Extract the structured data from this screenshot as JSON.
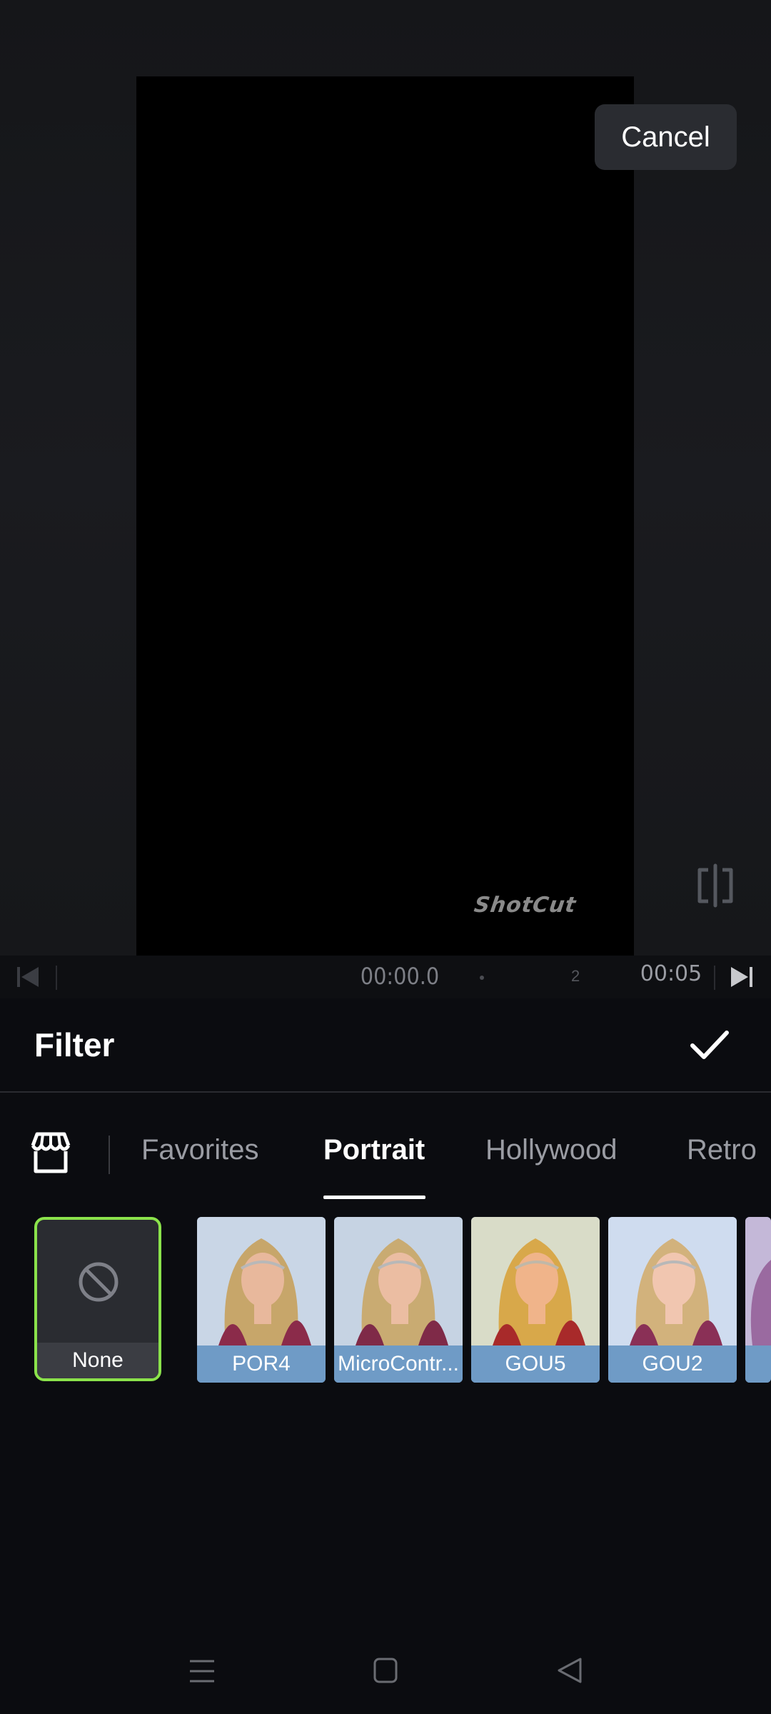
{
  "header": {
    "cancel_label": "Cancel"
  },
  "preview": {
    "watermark": "ShotCut"
  },
  "timeline": {
    "current_time": "00:00.0",
    "marker": "2",
    "end_time": "00:05"
  },
  "panel": {
    "title": "Filter"
  },
  "tabs": [
    {
      "label": "Favorites",
      "active": false
    },
    {
      "label": "Portrait",
      "active": true
    },
    {
      "label": "Hollywood",
      "active": false
    },
    {
      "label": "Retro",
      "active": false
    }
  ],
  "filters": [
    {
      "label": "None",
      "selected": true
    },
    {
      "label": "POR4",
      "selected": false
    },
    {
      "label": "MicroContr...",
      "selected": false
    },
    {
      "label": "GOU5",
      "selected": false
    },
    {
      "label": "GOU2",
      "selected": false
    }
  ],
  "colors": {
    "accent_selected": "#8be34b",
    "thumb_label_bg": "#6f9bc6",
    "background": "#0b0c10"
  },
  "icons": {
    "store": "store-icon",
    "compare": "compare-icon",
    "confirm": "checkmark-icon",
    "none": "prohibited-icon"
  }
}
